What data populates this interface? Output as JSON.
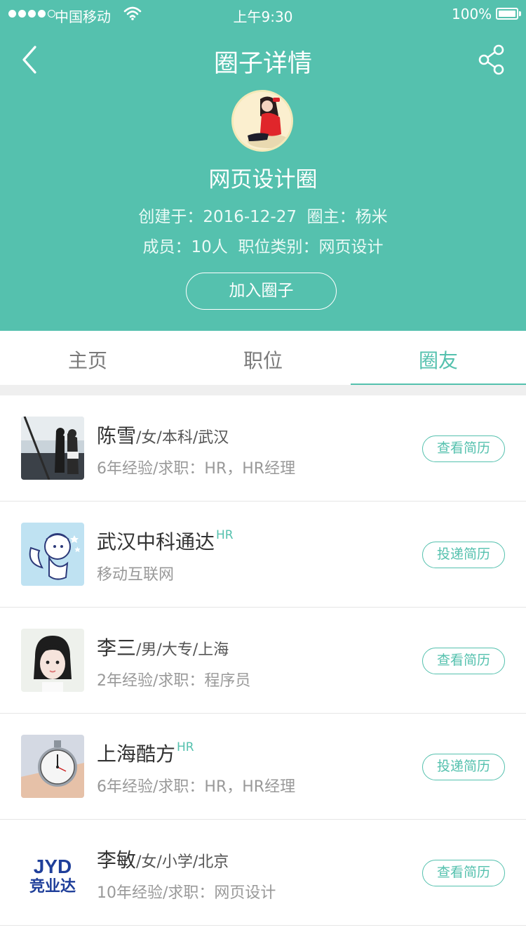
{
  "status_bar": {
    "carrier": "中国移动",
    "time": "上午9:30",
    "battery": "100%"
  },
  "nav": {
    "title": "圈子详情",
    "back_icon": "chevron-left-icon",
    "share_icon": "share-icon"
  },
  "circle": {
    "name": "网页设计圈",
    "created_label": "创建于：",
    "created_date": "2016-12-27",
    "owner_label": "圈主：",
    "owner": "杨米",
    "members_label": "成员：",
    "members": "10人",
    "category_label": "职位类别：",
    "category": "网页设计",
    "join_label": "加入圈子"
  },
  "tabs": [
    {
      "label": "主页",
      "active": false
    },
    {
      "label": "职位",
      "active": false
    },
    {
      "label": "圈友",
      "active": true
    }
  ],
  "members": [
    {
      "name": "陈雪",
      "meta": "/女/本科/武汉",
      "hr": "",
      "sub": "6年经验/求职：HR，HR经理",
      "action": "查看简历"
    },
    {
      "name": "武汉中科通达",
      "meta": "",
      "hr": "HR",
      "sub": "移动互联网",
      "action": "投递简历"
    },
    {
      "name": "李三",
      "meta": "/男/大专/上海",
      "hr": "",
      "sub": "2年经验/求职：程序员",
      "action": "查看简历"
    },
    {
      "name": "上海酷方",
      "meta": "",
      "hr": "HR",
      "sub": "6年经验/求职：HR，HR经理",
      "action": "投递简历"
    },
    {
      "name": "李敏",
      "meta": "/女/小学/北京",
      "hr": "",
      "sub": "10年经验/求职：网页设计",
      "action": "查看简历",
      "logo_text": "JYD 竞业达"
    }
  ],
  "colors": {
    "accent": "#55c1ae",
    "divider": "#efefef"
  }
}
